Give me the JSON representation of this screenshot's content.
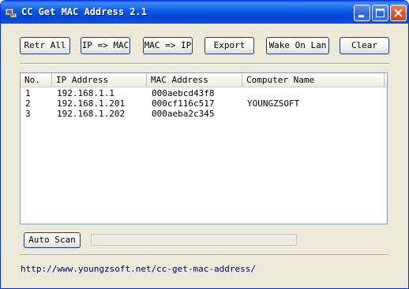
{
  "window": {
    "title": "CC Get MAC Address 2.1",
    "icon": "network-card-icon"
  },
  "toolbar": {
    "buttons": [
      {
        "label": "Retr All"
      },
      {
        "label": "IP => MAC"
      },
      {
        "label": "MAC => IP"
      },
      {
        "label": "Export"
      },
      {
        "label": "Wake On Lan"
      },
      {
        "label": "Clear"
      }
    ]
  },
  "table": {
    "columns": [
      "No.",
      "IP Address",
      "MAC Address",
      "Computer Name"
    ],
    "rows": [
      {
        "no": "1",
        "ip": "192.168.1.1",
        "mac": "000aebcd43f8",
        "name": ""
      },
      {
        "no": "2",
        "ip": "192.168.1.201",
        "mac": "000cf116c517",
        "name": "YOUNGZSOFT"
      },
      {
        "no": "3",
        "ip": "192.168.1.202",
        "mac": "000aeba2c345",
        "name": ""
      }
    ]
  },
  "scan": {
    "button_label": "Auto Scan",
    "progress": 0
  },
  "footer": {
    "link": "http://www.youngzsoft.net/cc-get-mac-address/"
  },
  "colors": {
    "titlebar": "#0a58e6",
    "dialog_bg": "#ece9d8",
    "link": "#00007f"
  }
}
